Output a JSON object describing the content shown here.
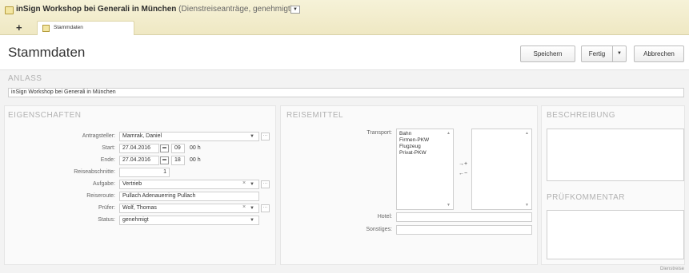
{
  "window": {
    "title_bold": "inSign Workshop bei Generali in München",
    "title_suffix": "(Dienstreiseanträge, genehmigt)",
    "menu_glyph": "▼",
    "new_tab_glyph": "+",
    "tab_label": "Stammdaten"
  },
  "header": {
    "title": "Stammdaten",
    "save_label": "Speichern",
    "done_label": "Fertig",
    "done_menu_glyph": "▼",
    "cancel_label": "Abbrechen"
  },
  "anlass": {
    "section_label": "ANLASS",
    "value": "inSign Workshop bei Generali in München"
  },
  "eigenschaften": {
    "section_label": "EIGENSCHAFTEN",
    "antragsteller_label": "Antragsteller:",
    "antragsteller_value": "Mamrak, Daniel",
    "start_label": "Start:",
    "start_date": "27.04.2016",
    "start_hour": "09",
    "start_min": "00 h",
    "ende_label": "Ende:",
    "ende_date": "27.04.2016",
    "ende_hour": "18",
    "ende_min": "00 h",
    "reiseabschnitte_label": "Reiseabschnitte:",
    "reiseabschnitte_value": "1",
    "aufgabe_label": "Aufgabe:",
    "aufgabe_value": "Vertrieb",
    "reiseroute_label": "Reiseroute:",
    "reiseroute_value": "Pullach Adenauerring Pullach",
    "pruefer_label": "Prüfer:",
    "pruefer_value": "Wolf, Thomas",
    "status_label": "Status:",
    "status_value": "genehmigt",
    "more_glyph": "···",
    "clear_glyph": "×",
    "dropdown_glyph": "▼"
  },
  "reisemittel": {
    "section_label": "REISEMITTEL",
    "transport_label": "Transport:",
    "transport_options": [
      "Bahn",
      "Firmen-PKW",
      "Flugzeug",
      "Privat-PKW"
    ],
    "add_glyph": "→+",
    "remove_glyph": "←−",
    "hotel_label": "Hotel:",
    "sonstiges_label": "Sonstiges:"
  },
  "beschreibung": {
    "section_label": "BESCHREIBUNG"
  },
  "pruefkommentar": {
    "section_label": "PRÜFKOMMENTAR"
  },
  "footer": {
    "text": "Dienstreise"
  }
}
